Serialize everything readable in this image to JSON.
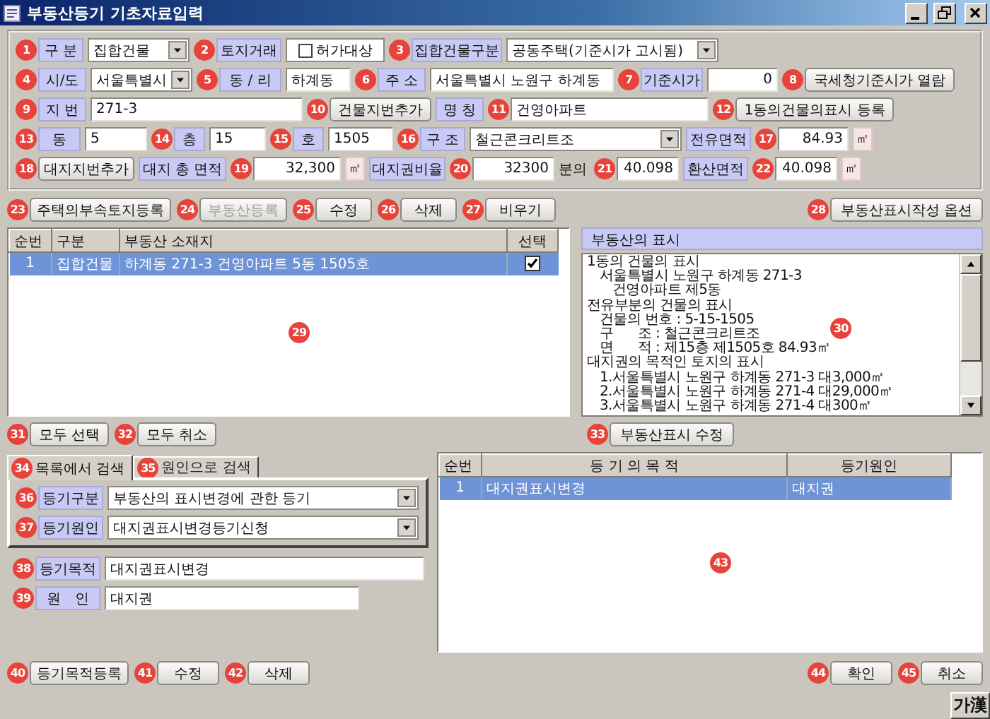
{
  "window": {
    "title": "부동산등기 기초자료입력"
  },
  "form_rows": [
    [
      {
        "kind": "label",
        "text": "구 분",
        "badge": "1"
      },
      {
        "kind": "select",
        "value": "집합건물"
      },
      {
        "kind": "label",
        "text": "토지거래",
        "badge": "2"
      },
      {
        "kind": "checkbox",
        "text": "허가대상",
        "checked": false
      },
      {
        "kind": "label",
        "text": "집합건물구분",
        "badge": "3"
      },
      {
        "kind": "select",
        "value": "공동주택(기준시가 고시됨)"
      }
    ],
    [
      {
        "kind": "label",
        "text": "시/도",
        "badge": "4"
      },
      {
        "kind": "select",
        "value": "서울특별시"
      },
      {
        "kind": "label",
        "text": "동 / 리",
        "badge": "5"
      },
      {
        "kind": "input",
        "value": "하계동"
      },
      {
        "kind": "label",
        "text": "주 소",
        "badge": "6"
      },
      {
        "kind": "input",
        "value": "서울특별시 노원구 하계동"
      },
      {
        "kind": "label",
        "text": "기준시가",
        "badge": "7"
      },
      {
        "kind": "number",
        "value": "0"
      },
      {
        "kind": "button",
        "text": "국세청기준시가 열람",
        "badge": "8",
        "disabled": false
      }
    ],
    [
      {
        "kind": "label",
        "text": "지 번",
        "badge": "9"
      },
      {
        "kind": "input",
        "value": "271-3"
      },
      {
        "kind": "button",
        "text": "건물지번추가",
        "badge": "10",
        "disabled": false
      },
      {
        "kind": "label",
        "text": "명 칭"
      },
      {
        "kind": "input",
        "value": "건영아파트",
        "badge": "11"
      },
      {
        "kind": "button",
        "text": "1동의건물의표시 등록",
        "badge": "12",
        "disabled": false
      }
    ],
    [
      {
        "kind": "label",
        "text": "동",
        "badge": "13"
      },
      {
        "kind": "input",
        "value": "5"
      },
      {
        "kind": "label",
        "text": "층",
        "badge": "14"
      },
      {
        "kind": "input",
        "value": "15"
      },
      {
        "kind": "label",
        "text": "호",
        "badge": "15"
      },
      {
        "kind": "input",
        "value": "1505"
      },
      {
        "kind": "label",
        "text": "구 조",
        "badge": "16"
      },
      {
        "kind": "select",
        "value": "철근콘크리트조"
      },
      {
        "kind": "label",
        "text": "전유면적"
      },
      {
        "kind": "number",
        "value": "84.93",
        "badge": "17"
      },
      {
        "kind": "unit",
        "text": "㎡"
      }
    ],
    [
      {
        "kind": "button",
        "text": "대지지번추가",
        "badge": "18",
        "disabled": false
      },
      {
        "kind": "label",
        "text": "대지 총 면적"
      },
      {
        "kind": "number",
        "value": "32,300",
        "badge": "19"
      },
      {
        "kind": "unit",
        "text": "㎡"
      },
      {
        "kind": "label",
        "text": "대지권비율"
      },
      {
        "kind": "number",
        "value": "32300",
        "badge": "20"
      },
      {
        "kind": "text",
        "text": "분의"
      },
      {
        "kind": "number",
        "value": "40.098",
        "badge": "21"
      },
      {
        "kind": "label",
        "text": "환산면적"
      },
      {
        "kind": "number",
        "value": "40.098",
        "badge": "22"
      },
      {
        "kind": "unit",
        "text": "㎡"
      }
    ]
  ],
  "actions": [
    {
      "text": "주택의부속토지등록",
      "badge": "23",
      "disabled": false
    },
    {
      "text": "부동산등록",
      "badge": "24",
      "disabled": true
    },
    {
      "text": "수정",
      "badge": "25",
      "disabled": false
    },
    {
      "text": "삭제",
      "badge": "26",
      "disabled": false
    },
    {
      "text": "비우기",
      "badge": "27",
      "disabled": false
    }
  ],
  "option_button": {
    "text": "부동산표시작성 옵션",
    "badge": "28",
    "disabled": false
  },
  "property_list": {
    "badge": "29",
    "columns": [
      "순번",
      "구분",
      "부동산 소재지",
      "선택"
    ],
    "rows": [
      {
        "cells": [
          "1",
          "집합건물",
          "하계동 271-3 건영아파트 5동 1505호"
        ],
        "checked": true,
        "selected": true
      }
    ]
  },
  "display_panel": {
    "title": "부동산의 표시",
    "badge": "30",
    "lines": [
      {
        "text": "1동의 건물의 표시",
        "children": [
          {
            "text": "서울특별시 노원구 하계동 271-3",
            "children": [
              {
                "text": "건영아파트 제5동"
              }
            ]
          }
        ]
      },
      {
        "text": "전유부분의 건물의 표시",
        "children": [
          {
            "text": "건물의 번호 : 5-15-1505"
          },
          {
            "text": "구      조 : 철근콘크리트조"
          },
          {
            "text": "면      적 : 제15층 제1505호 84.93㎡"
          }
        ]
      },
      {
        "text": "대지권의 목적인 토지의 표시",
        "children": [
          {
            "text": "1.서울특별시 노원구 하계동 271-3 대3,000㎡"
          },
          {
            "text": "2.서울특별시 노원구 하계동 271-4 대29,000㎡"
          },
          {
            "text": "3.서울특별시 노원구 하계동 271-4 대300㎡"
          }
        ]
      }
    ]
  },
  "select_buttons": [
    {
      "text": "모두 선택",
      "badge": "31",
      "disabled": false
    },
    {
      "text": "모두 취소",
      "badge": "32",
      "disabled": false
    }
  ],
  "edit_display_button": {
    "text": "부동산표시 수정",
    "badge": "33",
    "disabled": false
  },
  "search_tabs": [
    {
      "label": "목록에서 검색",
      "badge": "34",
      "selected": true
    },
    {
      "label": "원인으로 검색",
      "badge": "35",
      "selected": false
    }
  ],
  "search_fields": [
    {
      "label": "등기구분",
      "value": "부동산의 표시변경에 관한 등기",
      "badge": "36"
    },
    {
      "label": "등기원인",
      "value": "대지권표시변경등기신청",
      "badge": "37"
    }
  ],
  "purpose_fields": [
    {
      "label": "등기목적",
      "value": "대지권표시변경",
      "badge": "38"
    },
    {
      "label": "원   인",
      "value": "대지권",
      "badge": "39"
    }
  ],
  "purpose_list": {
    "badge": "43",
    "columns": [
      "순번",
      "등 기 의 목 적",
      "등기원인"
    ],
    "rows": [
      {
        "cells": [
          "1",
          "대지권표시변경",
          "대지권"
        ],
        "selected": true
      }
    ]
  },
  "bottom_left_buttons": [
    {
      "text": "등기목적등록",
      "badge": "40",
      "disabled": false
    },
    {
      "text": "수정",
      "badge": "41",
      "disabled": false
    },
    {
      "text": "삭제",
      "badge": "42",
      "disabled": false
    }
  ],
  "bottom_right_buttons": [
    {
      "text": "확인",
      "badge": "44",
      "disabled": false
    },
    {
      "text": "취소",
      "badge": "45",
      "disabled": false
    }
  ],
  "ime_indicator": "가漢"
}
